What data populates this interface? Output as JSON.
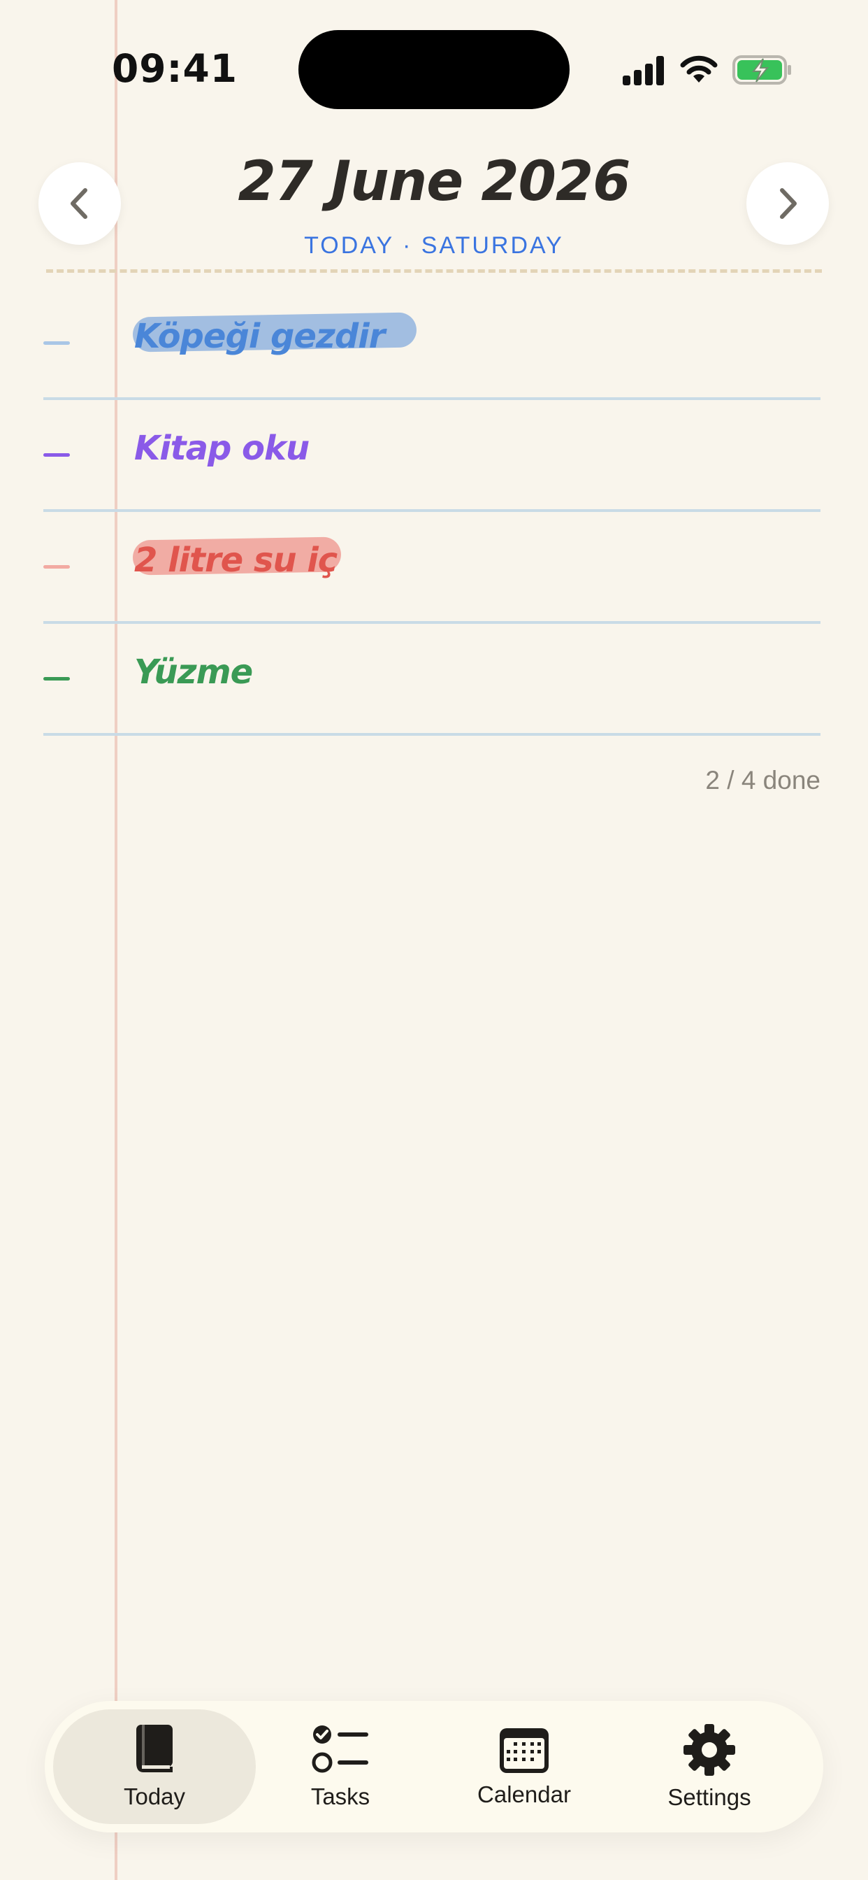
{
  "status_bar": {
    "time": "09:41"
  },
  "header": {
    "date": "27 June 2026",
    "subtitle": "TODAY · SATURDAY",
    "prev_icon": "chevron-left-icon",
    "next_icon": "chevron-right-icon"
  },
  "tasks": [
    {
      "text": "Köpeği gezdir",
      "color": "#4a86d8",
      "bullet_color": "#a9c6e6",
      "done": true,
      "highlight_color": "#9dbbe0"
    },
    {
      "text": "Kitap oku",
      "color": "#8a5ae8",
      "bullet_color": "#8a5ae8",
      "done": false
    },
    {
      "text": "2 litre su iç",
      "color": "#e0554d",
      "bullet_color": "#f2aaa2",
      "done": true,
      "highlight_color": "#f0a8a0"
    },
    {
      "text": "Yüzme",
      "color": "#3a9a55",
      "bullet_color": "#3a9a55",
      "done": false
    }
  ],
  "progress": {
    "label": "2 / 4 done",
    "completed": 2,
    "total": 4
  },
  "tab_bar": {
    "tabs": [
      {
        "label": "Today",
        "icon": "book-icon",
        "active": true
      },
      {
        "label": "Tasks",
        "icon": "checklist-icon",
        "active": false
      },
      {
        "label": "Calendar",
        "icon": "calendar-icon",
        "active": false
      },
      {
        "label": "Settings",
        "icon": "gear-icon",
        "active": false
      }
    ]
  }
}
